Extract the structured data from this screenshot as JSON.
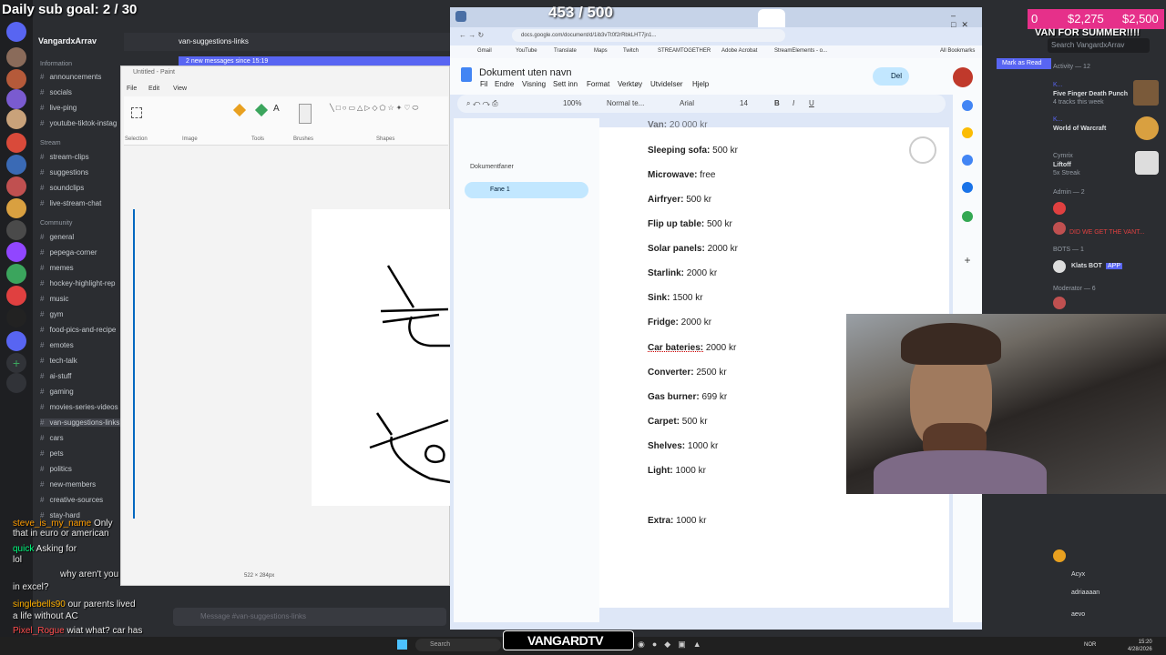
{
  "overlay": {
    "sub_goal": "Daily sub goal: 2 / 30",
    "viewer_count": "453 / 500",
    "donation_count": "0",
    "donation_amount": "$2,275",
    "donation_target": "$2,500",
    "donation_goal_label": "VAN FOR SUMMER!!!!",
    "watermark": "VANGARDTV"
  },
  "discord": {
    "server_name": "VangardxArrav",
    "header_channel": "van-suggestions-links",
    "notice": "2 new messages since 15:19",
    "categories": [
      {
        "label": "Information",
        "channels": [
          "announcements",
          "socials",
          "live-ping",
          "youtube-tiktok-instag"
        ]
      },
      {
        "label": "Stream",
        "channels": [
          "stream-clips",
          "suggestions",
          "soundclips",
          "live-stream-chat"
        ]
      },
      {
        "label": "Community",
        "channels": [
          "general",
          "pepega-corner",
          "memes",
          "hockey-highlight-rep",
          "music",
          "gym",
          "food-pics-and-recipe",
          "emotes",
          "tech-talk",
          "ai-stuff",
          "gaming",
          "movies-series-videos",
          "van-suggestions-links",
          "cars",
          "pets",
          "politics",
          "new-members",
          "creative-sources",
          "stay-hard"
        ]
      }
    ],
    "message_placeholder": "Message #van-suggestions-links",
    "search_placeholder": "Search VangardxArrav",
    "mark_as_read": "Mark as Read",
    "right_panel": {
      "activity_header": "Activity — 12",
      "activities": [
        {
          "name": "K...",
          "detail": "Five Finger Death Punch",
          "sub": "4 tracks this week"
        },
        {
          "name": "K...",
          "detail": "World of Warcraft",
          "sub": ""
        },
        {
          "name": "Cymrix",
          "detail": "Liftoff",
          "sub": "5x Streak"
        }
      ],
      "admin_header": "Admin — 2",
      "admin_line": "DID WE GET THE VANT...",
      "bots_header": "BOTS — 1",
      "bot_name": "Klats BOT",
      "bot_badge": "APP",
      "moderator_header": "Moderator — 6",
      "members": [
        "Acyx",
        "adriaaaan",
        "aevo"
      ]
    }
  },
  "chat": [
    {
      "user": "steve_is_my_name",
      "text": "Only"
    },
    {
      "user": "",
      "text": "that in euro or american"
    },
    {
      "user": "quick",
      "text": "Asking for"
    },
    {
      "user": "",
      "text": "lol"
    },
    {
      "user": "",
      "text": "why aren't you"
    },
    {
      "user": "",
      "text": "in excel?"
    },
    {
      "user": "singlebells90",
      "text": "our parents lived"
    },
    {
      "user": "",
      "text": "a life without AC"
    },
    {
      "user": "Pixel_Rogue",
      "text": "wiat what? car has"
    }
  ],
  "paint": {
    "title": "Untitled - Paint",
    "menus": [
      "File",
      "Edit",
      "View"
    ],
    "groups": [
      "Selection",
      "Image",
      "Tools",
      "Brushes",
      "Shapes"
    ],
    "status_size": "522 × 284px"
  },
  "browser": {
    "url": "docs.google.com/document/d/1ib3vTt0f2rRbkLHT7jn1...",
    "bookmarks": [
      "Gmail",
      "YouTube",
      "Translate",
      "Maps",
      "Twitch",
      "STREAMTOGETHER",
      "Adobe Acrobat",
      "StreamElements - o...",
      "All Bookmarks"
    ]
  },
  "docs": {
    "title": "Dokument uten navn",
    "menus": [
      "Fil",
      "Endre",
      "Visning",
      "Sett inn",
      "Format",
      "Verktøy",
      "Utvidelser",
      "Hjelp"
    ],
    "share": "Del",
    "zoom": "100%",
    "style": "Normal te...",
    "font": "Arial",
    "font_size": "14",
    "tabs_label": "Dokumentfaner",
    "tab1": "Fane 1",
    "items": [
      {
        "name": "Van:",
        "price": "20 000 kr",
        "partial": true
      },
      {
        "name": "Sleeping sofa:",
        "price": "500 kr"
      },
      {
        "name": "Microwave:",
        "price": "free"
      },
      {
        "name": "Airfryer:",
        "price": "500 kr"
      },
      {
        "name": "Flip up table:",
        "price": "500 kr"
      },
      {
        "name": "Solar panels:",
        "price": "2000 kr"
      },
      {
        "name": "Starlink:",
        "price": "2000 kr"
      },
      {
        "name": "Sink:",
        "price": "1500 kr"
      },
      {
        "name": "Fridge:",
        "price": "2000 kr"
      },
      {
        "name": "Car bateries:",
        "price": "2000 kr"
      },
      {
        "name": "Converter:",
        "price": "2500 kr"
      },
      {
        "name": "Gas burner:",
        "price": "699 kr"
      },
      {
        "name": "Carpet:",
        "price": "500 kr"
      },
      {
        "name": "Shelves:",
        "price": "1000 kr"
      },
      {
        "name": "Light:",
        "price": "1000 kr"
      },
      {
        "name": "Extra:",
        "price": "1000 kr"
      }
    ]
  },
  "taskbar": {
    "search": "Search",
    "lang": "NOR",
    "time": "15:20",
    "date": "4/28/2026"
  }
}
